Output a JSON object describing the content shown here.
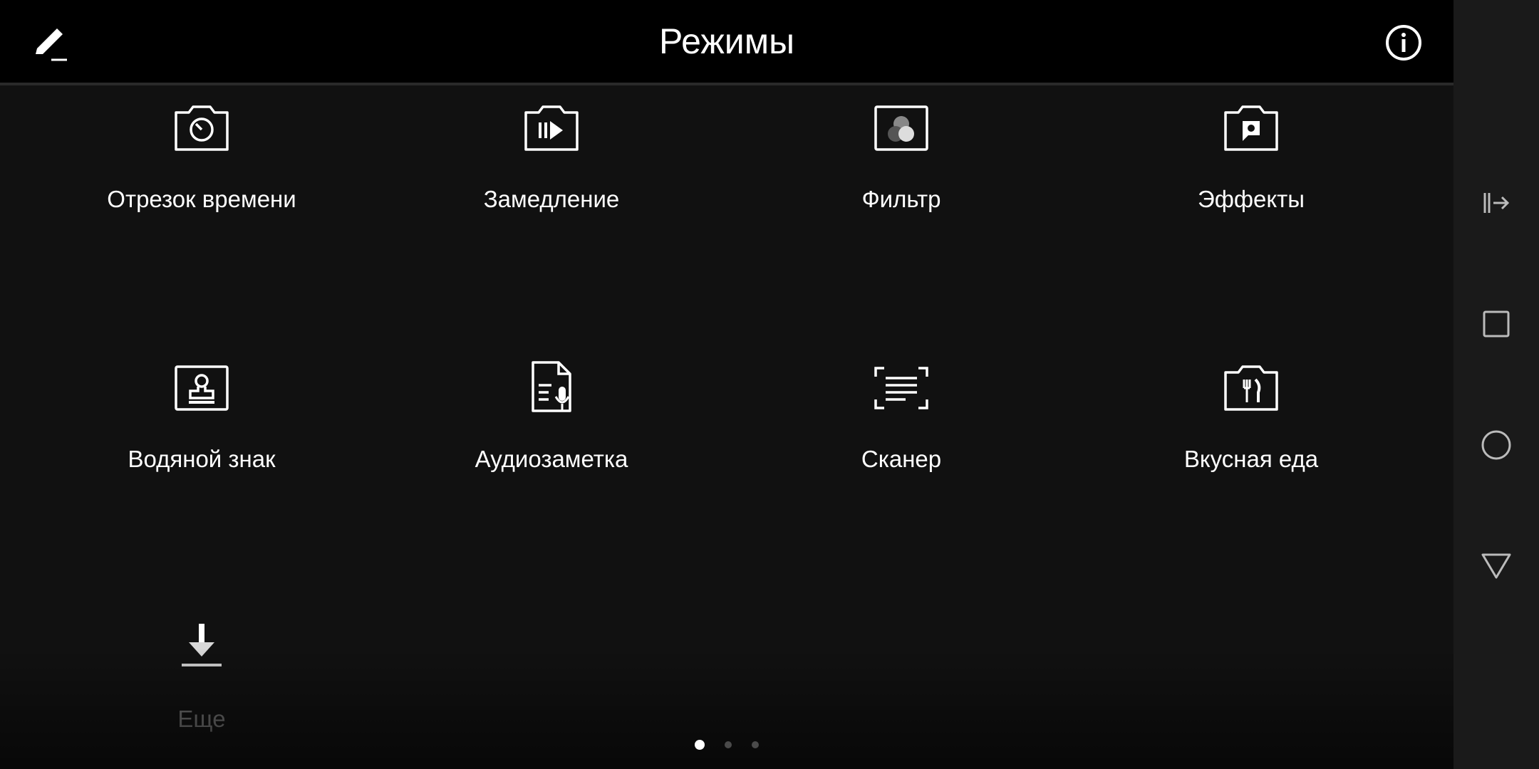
{
  "header": {
    "title": "Режимы",
    "edit_icon": "pencil-icon",
    "info_icon": "info-icon"
  },
  "modes": [
    {
      "label": "Отрезок времени",
      "icon": "timelapse-camera-icon"
    },
    {
      "label": "Замедление",
      "icon": "slow-motion-camera-icon"
    },
    {
      "label": "Фильтр",
      "icon": "filter-icon"
    },
    {
      "label": "Эффекты",
      "icon": "effects-camera-icon"
    },
    {
      "label": "Водяной знак",
      "icon": "watermark-stamp-icon"
    },
    {
      "label": "Аудиозаметка",
      "icon": "audio-note-icon"
    },
    {
      "label": "Сканер",
      "icon": "document-scanner-icon"
    },
    {
      "label": "Вкусная еда",
      "icon": "food-camera-icon"
    },
    {
      "label": "Еще",
      "icon": "download-icon"
    }
  ],
  "pager": {
    "pages": 3,
    "active": 1
  },
  "navbar": {
    "icons": [
      "side-panel-icon",
      "recents-square-icon",
      "home-circle-icon",
      "back-triangle-icon"
    ]
  },
  "colors": {
    "background": "#111111",
    "header": "#000000",
    "text": "#ffffff",
    "dim_text": "#6b6b6b",
    "navbar": "#1a1a1a"
  }
}
